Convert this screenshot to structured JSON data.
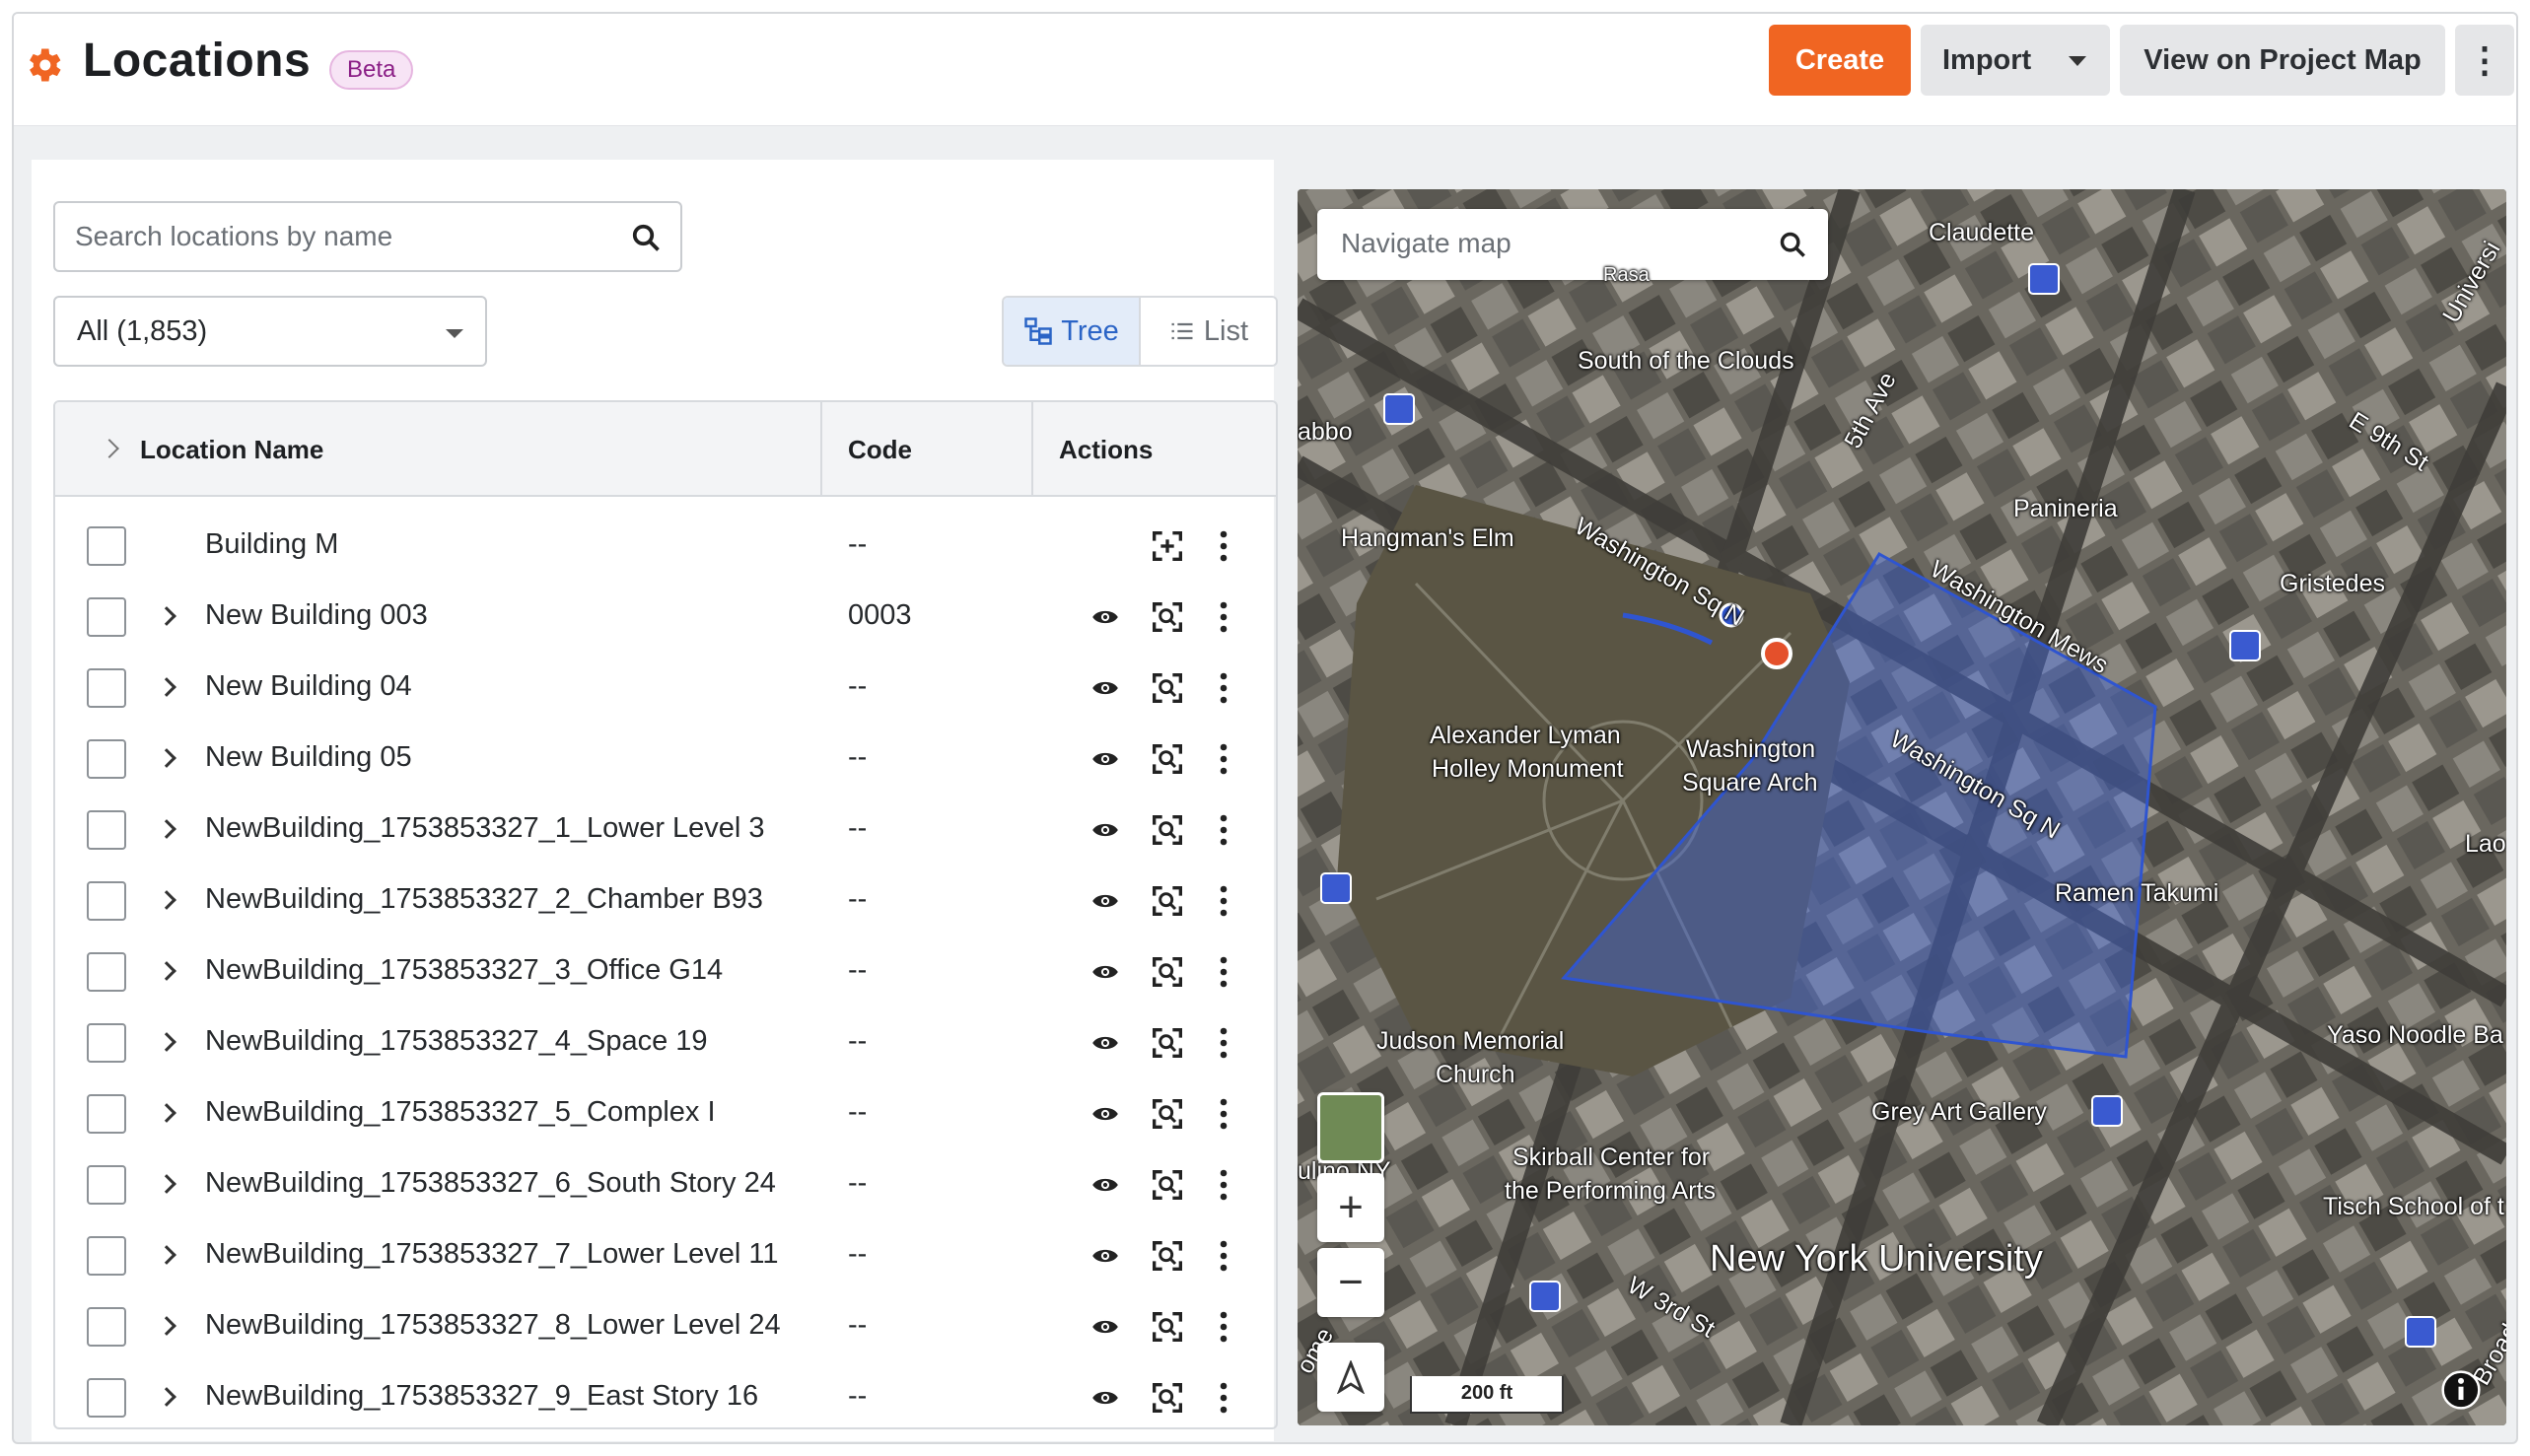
{
  "header": {
    "title": "Locations",
    "badge": "Beta",
    "create_label": "Create",
    "import_label": "Import",
    "view_map_label": "View on Project Map",
    "more_label": "⋮",
    "accent_color": "#f06522"
  },
  "search": {
    "placeholder": "Search locations by name"
  },
  "filter": {
    "selected": "All (1,853)"
  },
  "view_toggle": {
    "tree_label": "Tree",
    "list_label": "List",
    "active": "tree"
  },
  "table": {
    "columns": [
      "Location Name",
      "Code",
      "Actions"
    ],
    "rows": [
      {
        "name": "Building M",
        "code": "--",
        "expandable": false,
        "has_eye": false
      },
      {
        "name": "New Building 003",
        "code": "0003",
        "expandable": true,
        "has_eye": true
      },
      {
        "name": "New Building 04",
        "code": "--",
        "expandable": true,
        "has_eye": true
      },
      {
        "name": "New Building 05",
        "code": "--",
        "expandable": true,
        "has_eye": true
      },
      {
        "name": "NewBuilding_1753853327_1_Lower Level 3",
        "code": "--",
        "expandable": true,
        "has_eye": true
      },
      {
        "name": "NewBuilding_1753853327_2_Chamber B93",
        "code": "--",
        "expandable": true,
        "has_eye": true
      },
      {
        "name": "NewBuilding_1753853327_3_Office G14",
        "code": "--",
        "expandable": true,
        "has_eye": true
      },
      {
        "name": "NewBuilding_1753853327_4_Space 19",
        "code": "--",
        "expandable": true,
        "has_eye": true
      },
      {
        "name": "NewBuilding_1753853327_5_Complex I",
        "code": "--",
        "expandable": true,
        "has_eye": true
      },
      {
        "name": "NewBuilding_1753853327_6_South Story 24",
        "code": "--",
        "expandable": true,
        "has_eye": true
      },
      {
        "name": "NewBuilding_1753853327_7_Lower Level 11",
        "code": "--",
        "expandable": true,
        "has_eye": true
      },
      {
        "name": "NewBuilding_1753853327_8_Lower Level 24",
        "code": "--",
        "expandable": true,
        "has_eye": true
      },
      {
        "name": "NewBuilding_1753853327_9_East Story 16",
        "code": "--",
        "expandable": true,
        "has_eye": true
      }
    ]
  },
  "map": {
    "search_placeholder": "Navigate map",
    "zoom_in": "+",
    "zoom_out": "−",
    "scale": "200 ft",
    "labels": {
      "claudette": "Claudette",
      "rasa": "Rasa",
      "south_of_clouds": "South of the Clouds",
      "abbo": "abbo",
      "fifth_ave": "5th Ave",
      "e9th": "E 9th St",
      "panineria": "Panineria",
      "hangmans_elm": "Hangman's Elm",
      "washington_sq_n_1": "Washington Sq N",
      "washington_mews": "Washington Mews",
      "gristedes": "Gristedes",
      "universi": "Universi",
      "alexander": "Alexander Lyman",
      "holley": "Holley Monument",
      "washington_square": "Washington",
      "square_arch": "Square Arch",
      "washington_sq_n_2": "Washington Sq N",
      "lao": "Lao",
      "ramen": "Ramen Takumi",
      "judson": "Judson Memorial",
      "church": "Church",
      "yaso": "Yaso Noodle Ba",
      "grey_art": "Grey Art Gallery",
      "skirball": "Skirball Center for",
      "performing": "the Performing Arts",
      "ulino": "ulino NY",
      "tisch": "Tisch School of t",
      "nyu": "New York University",
      "w3rd": "W 3rd St",
      "broadw": "Broadw",
      "ome": "ome"
    },
    "polygon_color": "#3d63d8",
    "marker_color": "#f06522"
  }
}
